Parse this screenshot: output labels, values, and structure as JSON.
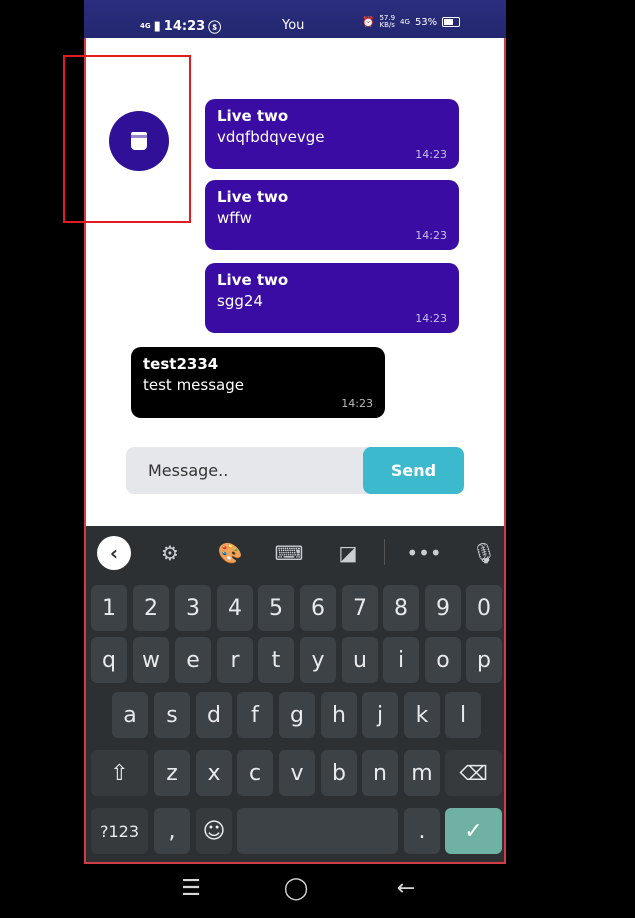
{
  "status_bar": {
    "network_left": "4G",
    "time": "14:23",
    "title": "You",
    "speed_value": "57.9",
    "speed_unit": "KB/s",
    "network_right": "4G",
    "battery": "53%"
  },
  "messages": [
    {
      "sender": "Live two",
      "text": "vdqfbdqvevge",
      "time": "14:23",
      "mine": true
    },
    {
      "sender": "Live two",
      "text": "wffw",
      "time": "14:23",
      "mine": true
    },
    {
      "sender": "Live two",
      "text": "sgg24",
      "time": "14:23",
      "mine": true
    },
    {
      "sender": "test2334",
      "text": "test message",
      "time": "14:23",
      "mine": false
    }
  ],
  "composer": {
    "placeholder": "Message..",
    "send_label": "Send"
  },
  "keyboard": {
    "row_numbers": [
      "1",
      "2",
      "3",
      "4",
      "5",
      "6",
      "7",
      "8",
      "9",
      "0"
    ],
    "row_1": [
      "q",
      "w",
      "e",
      "r",
      "t",
      "y",
      "u",
      "i",
      "o",
      "p"
    ],
    "row_2": [
      "a",
      "s",
      "d",
      "f",
      "g",
      "h",
      "j",
      "k",
      "l"
    ],
    "row_3": [
      "z",
      "x",
      "c",
      "v",
      "b",
      "n",
      "m"
    ],
    "symbols_label": "?123",
    "comma": ",",
    "period": ".",
    "shift_icon": "shift-icon",
    "backspace_icon": "backspace-icon",
    "enter_icon": "checkmark-icon"
  },
  "colors": {
    "bubble_mine": "#3a0ca3",
    "bubble_theirs": "#000000",
    "send_button": "#3db9cd",
    "fab": "#2f1096"
  }
}
